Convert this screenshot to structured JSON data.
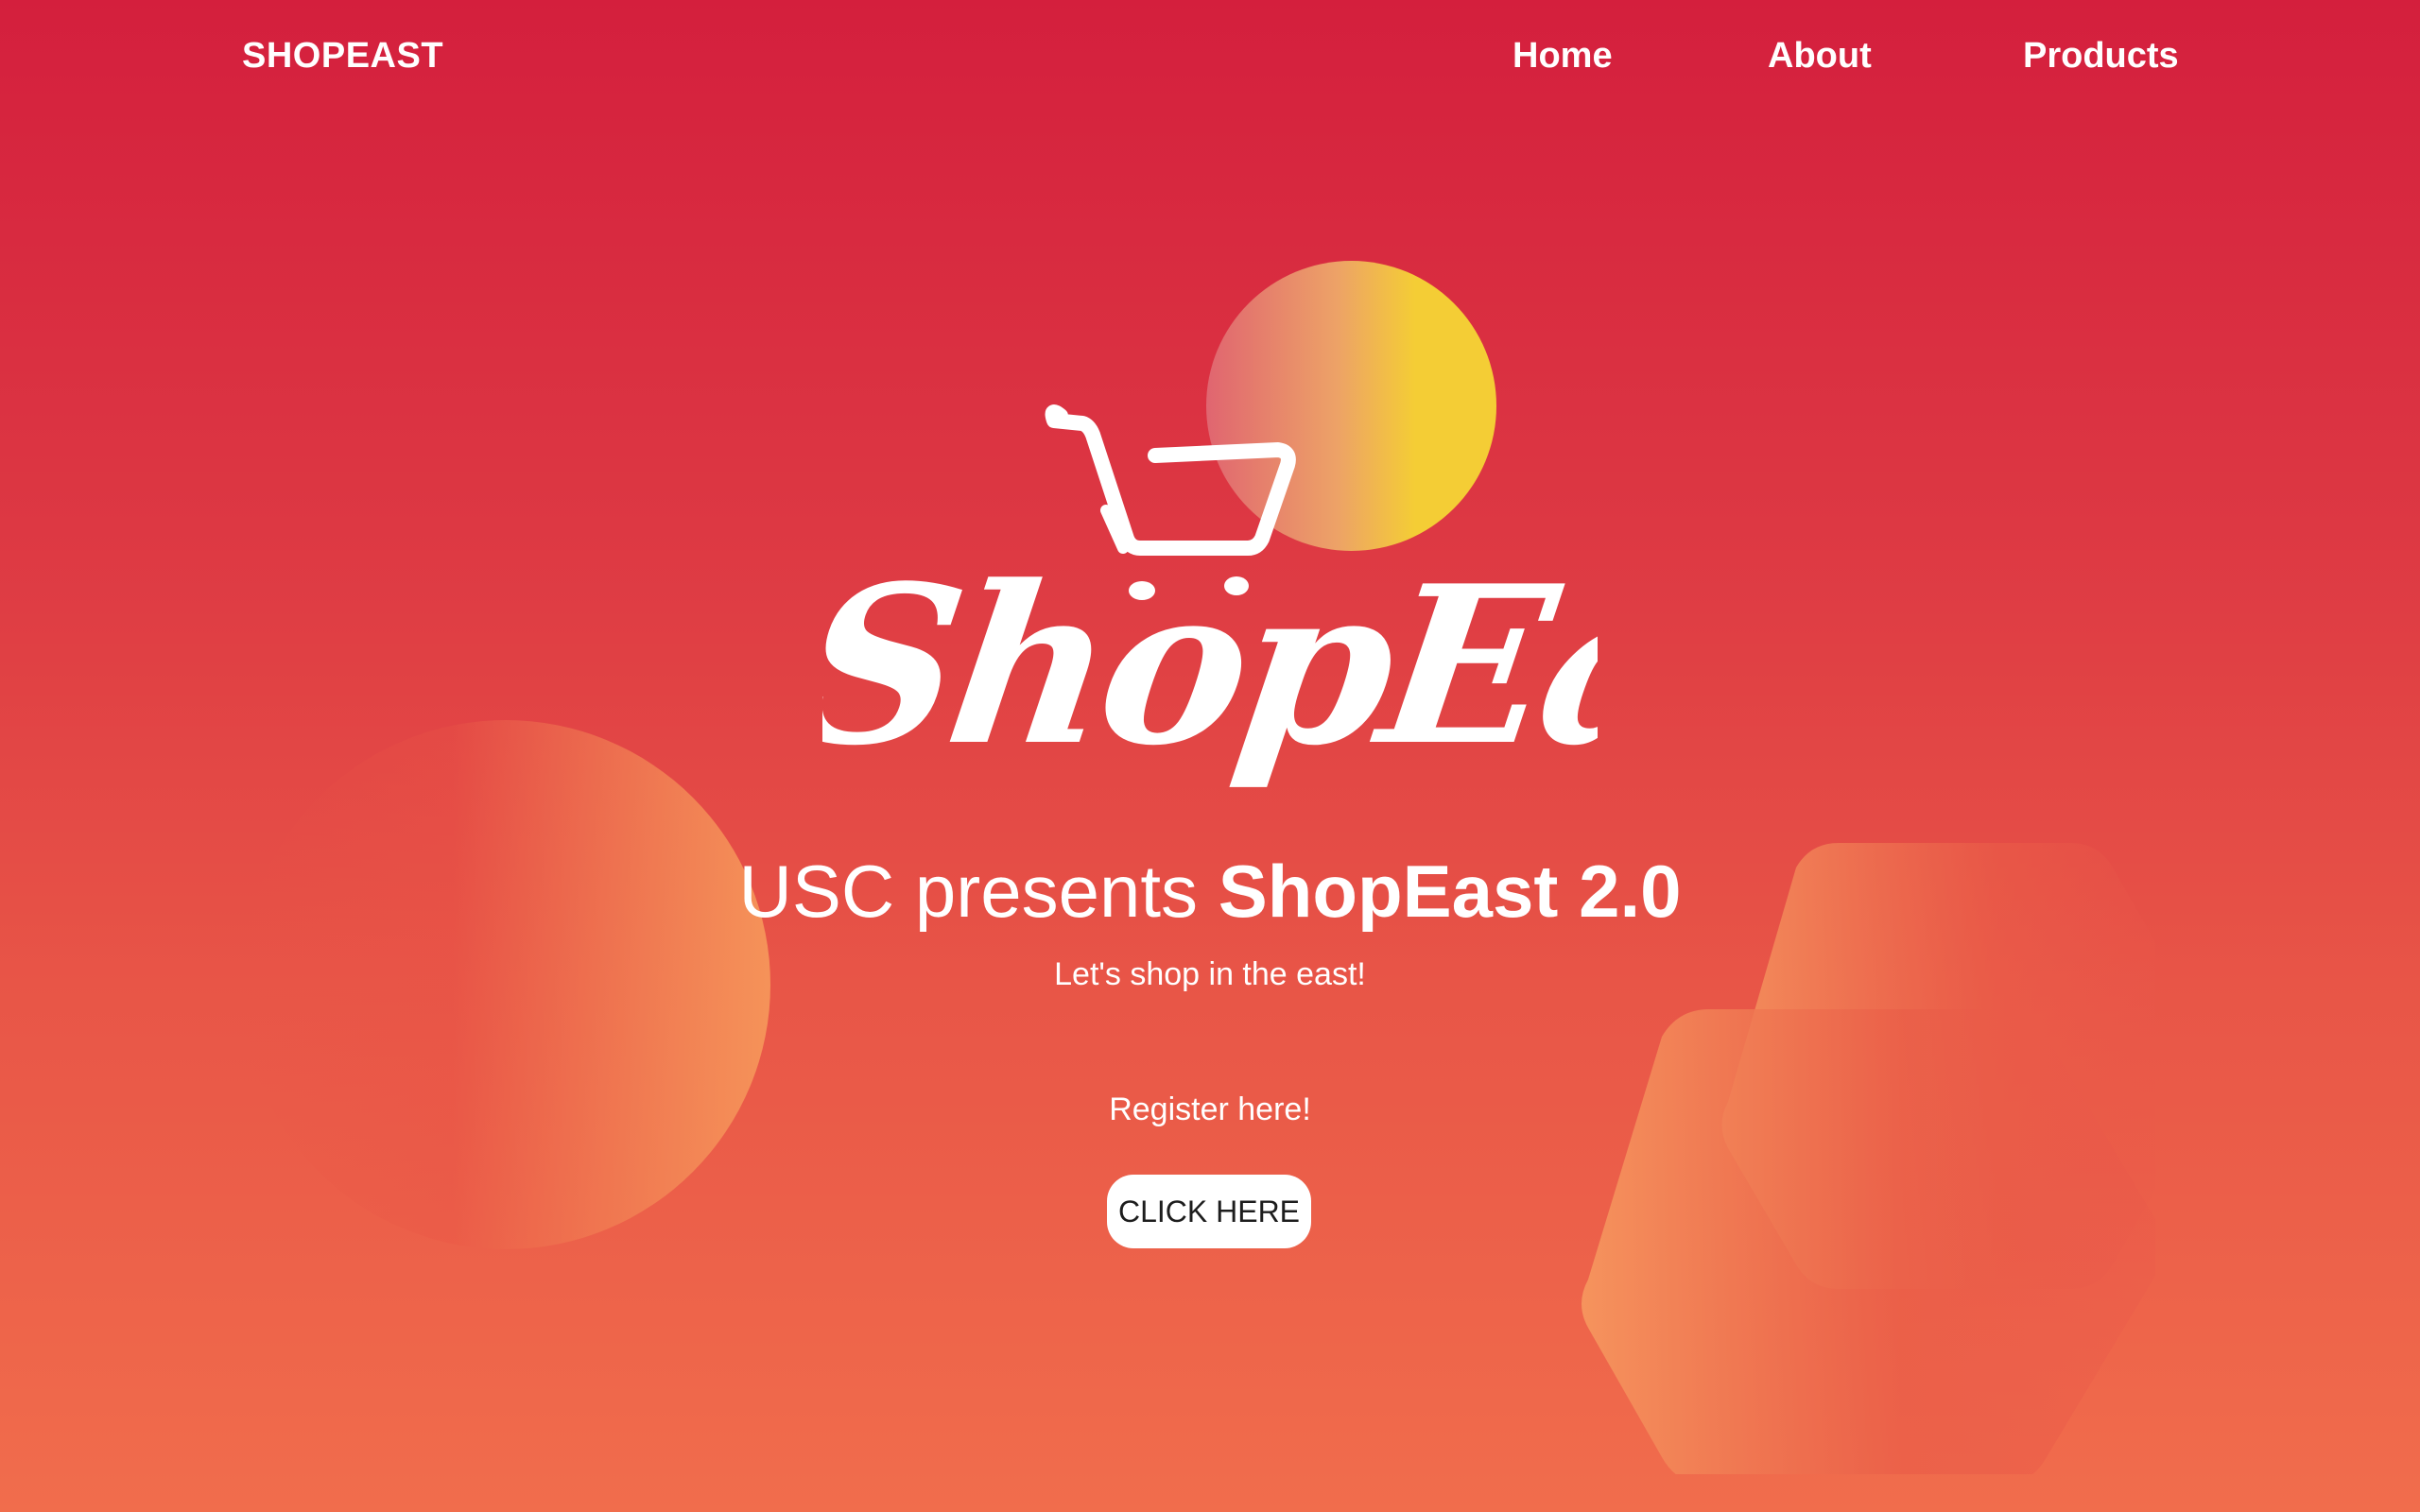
{
  "nav": {
    "brand": "SHOPEAST",
    "links": [
      {
        "label": "Home"
      },
      {
        "label": "About"
      },
      {
        "label": "Products"
      }
    ]
  },
  "logo": {
    "text": "ShopEast",
    "icon": "shopping-cart-icon"
  },
  "hero": {
    "title_prefix": "USC presents ",
    "title_strong": "ShopEast 2.0",
    "subtitle": "Let's shop in the east!",
    "register_label": "Register here!",
    "cta_label": "CLICK HERE"
  },
  "colors": {
    "bg_top": "#d41f3d",
    "bg_bottom": "#f16d4c",
    "sun": "#f4cd35",
    "button_bg": "#ffffff",
    "button_text": "#1d1d1d"
  }
}
